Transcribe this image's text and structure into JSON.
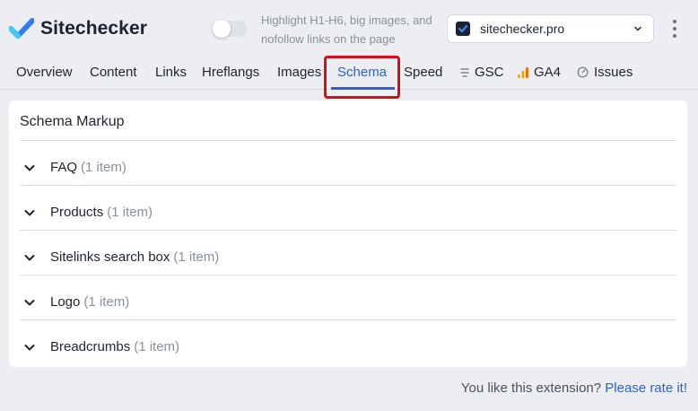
{
  "header": {
    "brand_name": "Sitechecker",
    "logo_icon": "sitechecker-logo-icon",
    "highlight_toggle_on": false,
    "highlight_text": "Highlight H1-H6, big images, and nofollow links on the page",
    "domain_select": {
      "value": "sitechecker.pro",
      "icon": "chevron-down-icon"
    },
    "menu_icon": "kebab-menu-icon"
  },
  "tabs": [
    {
      "label": "Overview"
    },
    {
      "label": "Content"
    },
    {
      "label": "Links"
    },
    {
      "label": "Hreflangs"
    },
    {
      "label": "Images"
    },
    {
      "label": "Schema",
      "active": true
    },
    {
      "label": "Speed"
    },
    {
      "label": "GSC",
      "icon": "gsc-icon"
    },
    {
      "label": "GA4",
      "icon": "ga4-icon"
    },
    {
      "label": "Issues",
      "icon": "gauge-icon"
    }
  ],
  "schema": {
    "title": "Schema Markup",
    "items": [
      {
        "name": "FAQ",
        "count": "(1 item)"
      },
      {
        "name": "Products",
        "count": "(1 item)"
      },
      {
        "name": "Sitelinks search box",
        "count": "(1 item)"
      },
      {
        "name": "Logo",
        "count": "(1 item)"
      },
      {
        "name": "Breadcrumbs",
        "count": "(1 item)"
      }
    ]
  },
  "footer": {
    "prompt": "You like this extension?",
    "link_text": "Please rate it!"
  },
  "colors": {
    "accent": "#2f5fd8",
    "highlight_box": "#d40f16",
    "background": "#eceef2"
  }
}
